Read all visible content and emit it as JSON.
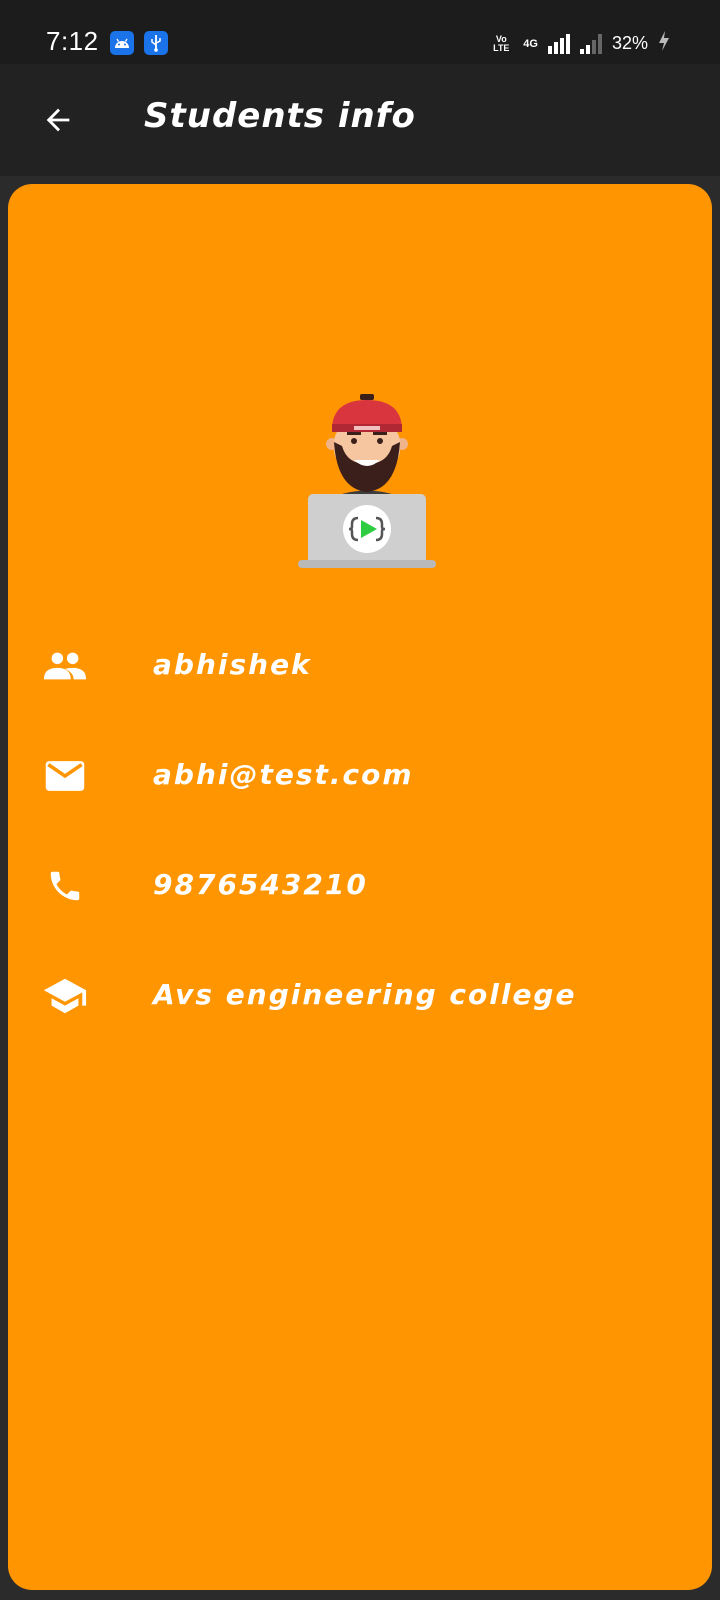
{
  "status_bar": {
    "time": "7:12",
    "battery": "32%",
    "network": "4G",
    "volte": "Vo LTE",
    "icons": [
      "android-icon",
      "usb-icon",
      "signal-icon",
      "battery-charging-icon"
    ]
  },
  "app_bar": {
    "title": "Students info",
    "back_icon": "arrow-back-icon"
  },
  "student": {
    "avatar_icon": "developer-avatar-icon",
    "name": "abhishek",
    "email": "abhi@test.com",
    "phone": "9876543210",
    "college": "Avs engineering college"
  },
  "colors": {
    "card": "#ff9500",
    "app_bar": "#222222",
    "status_bar": "#1c1c1c",
    "text": "#ffffff"
  }
}
